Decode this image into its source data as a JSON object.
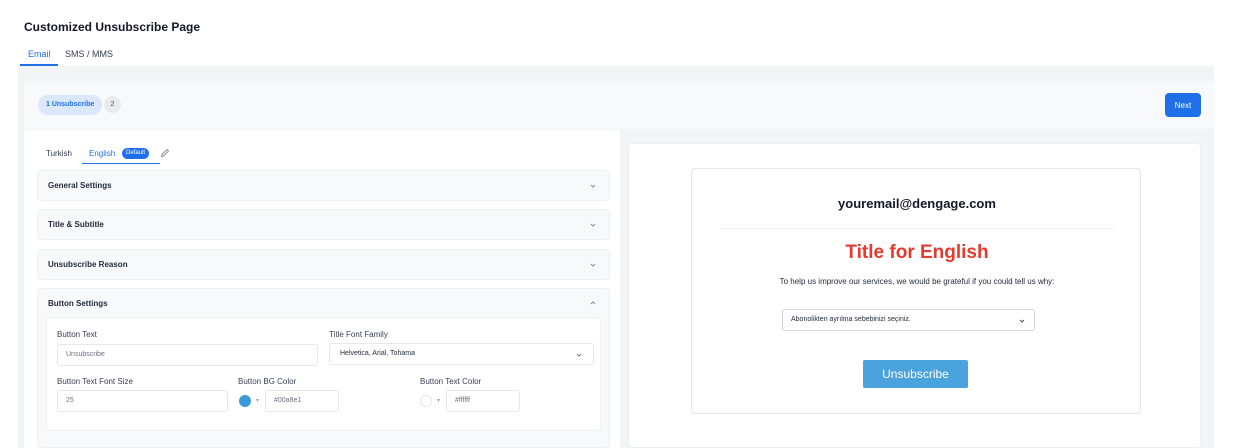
{
  "page": {
    "title": "Customized Unsubscribe Page"
  },
  "channel_tabs": [
    {
      "label": "Email",
      "active": true
    },
    {
      "label": "SMS / MMS",
      "active": false
    }
  ],
  "stepper": {
    "step1_label": "1 Unsubscribe",
    "step2_label": "2",
    "next_label": "Next"
  },
  "language_tabs": {
    "turkish_label": "Turkish",
    "english_label": "English",
    "default_badge": "Default"
  },
  "sections": {
    "general": "General Settings",
    "title_subtitle": "Title & Subtitle",
    "reason": "Unsubscribe Reason",
    "button": "Button Settings"
  },
  "button_settings": {
    "button_text_label": "Button Text",
    "button_text_value": "Unsubscribe",
    "font_family_label": "Title Font Family",
    "font_family_value": "Helvetica, Arial, Tohama",
    "font_size_label": "Button Text Font Size",
    "font_size_value": "25",
    "bg_color_label": "Button BG Color",
    "bg_color_value": "#00a8e1",
    "text_color_label": "Button Text Color",
    "text_color_value": "#ffffff"
  },
  "preview": {
    "email": "youremail@dengage.com",
    "title": "Title for English",
    "subtitle": "To help us improve our services, we would be grateful if you could tell us why:",
    "reason_select": "Abonolikten ayrılma sebebinizi seçiniz.",
    "button_label": "Unsubscribe"
  },
  "colors": {
    "accent": "#1e6fe8",
    "preview_title": "#e53a2e",
    "preview_button": "#4aa3dc",
    "bg_swatch": "#3b9ad9",
    "text_swatch": "#ffffff"
  },
  "icons": {
    "edit": "pencil-icon",
    "collapse": "chevron-down-icon",
    "expand": "chevron-up-icon"
  }
}
